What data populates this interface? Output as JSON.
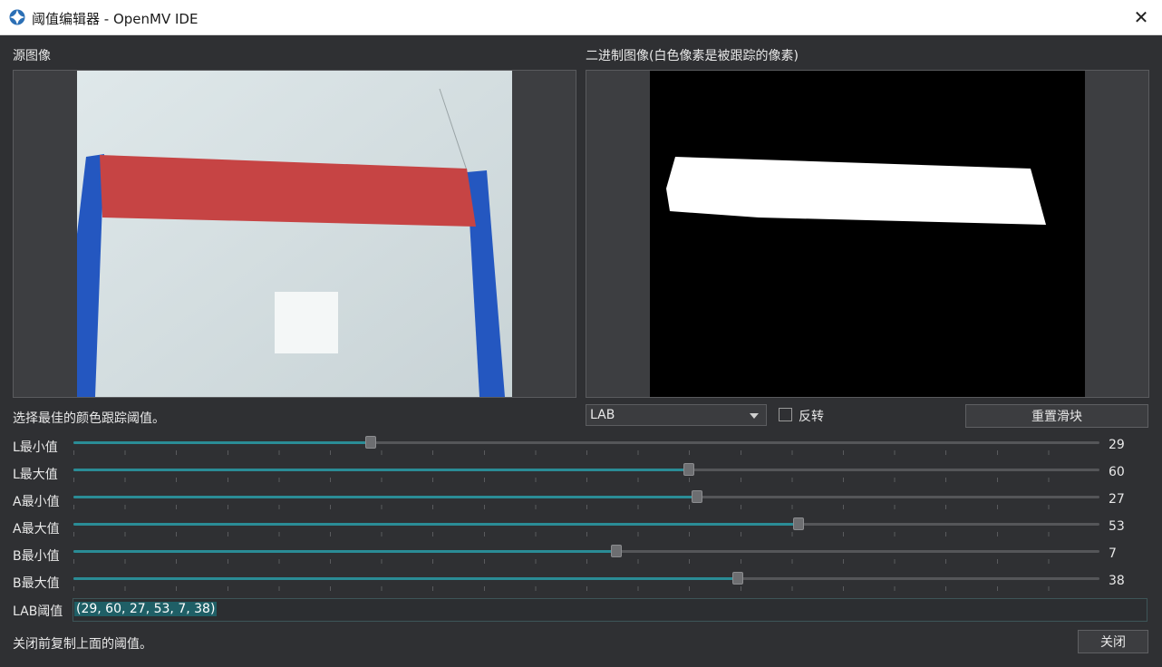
{
  "window": {
    "title": "阈值编辑器 - OpenMV IDE",
    "close_icon": "close-icon"
  },
  "source": {
    "label": "源图像"
  },
  "binary": {
    "label": "二进制图像(白色像素是被跟踪的像素)"
  },
  "hint": {
    "text": "选择最佳的颜色跟踪阈值。"
  },
  "colorspace": {
    "selected": "LAB"
  },
  "invert": {
    "label": "反转",
    "checked": false
  },
  "reset_button": {
    "label": "重置滑块"
  },
  "sliders": [
    {
      "label": "L最小值",
      "value": "29",
      "fraction": 0.29
    },
    {
      "label": "L最大值",
      "value": "60",
      "fraction": 0.6
    },
    {
      "label": "A最小值",
      "value": "27",
      "fraction": 0.6075
    },
    {
      "label": "A最大值",
      "value": "53",
      "fraction": 0.7067
    },
    {
      "label": "B最小值",
      "value": "7",
      "fraction": 0.5295
    },
    {
      "label": "B最大值",
      "value": "38",
      "fraction": 0.6477
    }
  ],
  "threshold": {
    "label": "LAB阈值",
    "value": "(29, 60, 27, 53, 7, 38)"
  },
  "footer": {
    "hint": "关闭前复制上面的阈值。",
    "close_label": "关闭"
  },
  "colors": {
    "accent": "#2a8c96",
    "background": "#2f3033",
    "red_tape": "#c64444",
    "blue_tape": "#2457c0"
  }
}
